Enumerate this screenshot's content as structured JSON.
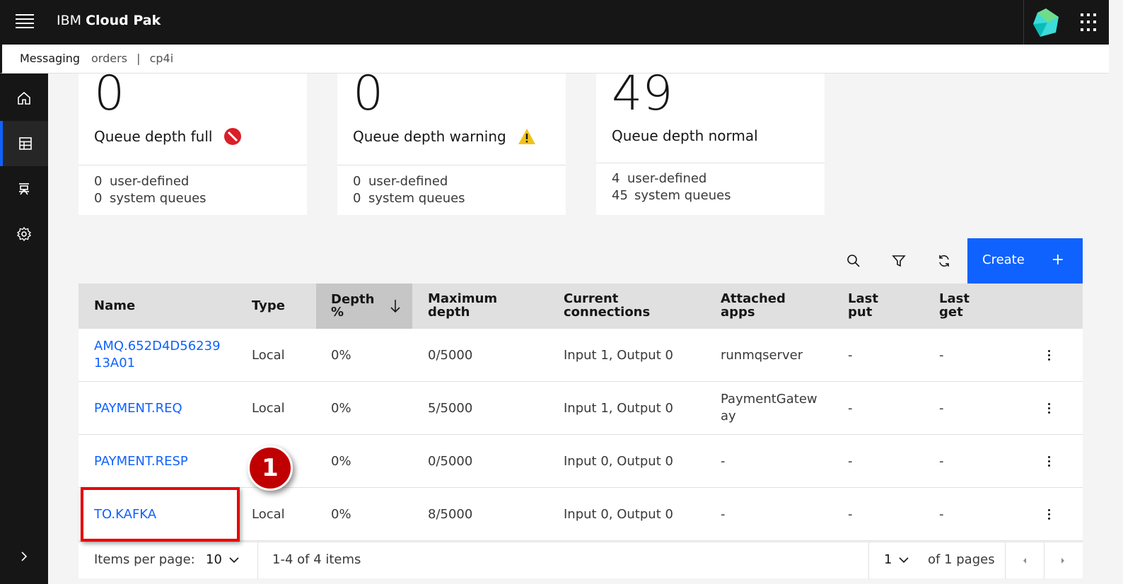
{
  "header": {
    "brand_ibm": "IBM",
    "brand_product": "Cloud Pak"
  },
  "breadcrumb": {
    "app": "Messaging",
    "path": [
      "orders",
      "|",
      "cp4i"
    ]
  },
  "nav": {
    "items": [
      "home-icon",
      "table-icon",
      "queue-manager-icon",
      "settings-icon"
    ],
    "active": "table-icon",
    "expand": "chevron-right-icon"
  },
  "cards": [
    {
      "count": "0",
      "title": "Queue depth full",
      "icon": "error-icon",
      "user_n": "0",
      "user_label": "user-defined",
      "system_n": "0",
      "system_label": "system queues"
    },
    {
      "count": "0",
      "title": "Queue depth warning",
      "icon": "warning-icon",
      "user_n": "0",
      "user_label": "user-defined",
      "system_n": "0",
      "system_label": "system queues"
    },
    {
      "count": "49",
      "title": "Queue depth normal",
      "icon": "",
      "user_n": "4",
      "user_label": "user-defined",
      "system_n": "45",
      "system_label": "system queues"
    }
  ],
  "toolbar": {
    "create_label": "Create",
    "create_icon": "+"
  },
  "table": {
    "headers": {
      "name": "Name",
      "type": "Type",
      "depth1": "Depth",
      "depth2": "%",
      "max1": "Maximum",
      "max2": "depth",
      "conn1": "Current",
      "conn2": "connections",
      "apps1": "Attached",
      "apps2": "apps",
      "put1": "Last",
      "put2": "put",
      "get1": "Last",
      "get2": "get"
    },
    "rows": [
      {
        "name1": "AMQ.652D4D56239",
        "name2": "13A01",
        "type": "Local",
        "depth": "0%",
        "max": "0/5000",
        "conn": "Input 1, Output 0",
        "apps1": "runmqserver",
        "apps2": "",
        "put": "-",
        "get": "-"
      },
      {
        "name1": "PAYMENT.REQ",
        "name2": "",
        "type": "Local",
        "depth": "0%",
        "max": "5/5000",
        "conn": "Input 1, Output 0",
        "apps1": "PaymentGatew",
        "apps2": "ay",
        "put": "-",
        "get": "-"
      },
      {
        "name1": "PAYMENT.RESP",
        "name2": "",
        "type": "",
        "depth": "0%",
        "max": "0/5000",
        "conn": "Input 0, Output 0",
        "apps1": "-",
        "apps2": "",
        "put": "-",
        "get": "-"
      },
      {
        "name1": "TO.KAFKA",
        "name2": "",
        "type": "Local",
        "depth": "0%",
        "max": "8/5000",
        "conn": "Input 0, Output 0",
        "apps1": "-",
        "apps2": "",
        "put": "-",
        "get": "-"
      }
    ]
  },
  "pagination": {
    "items_per_page_label": "Items per page:",
    "items_per_page": "10",
    "range": "1-4 of 4 items",
    "page": "1",
    "of_pages": "of 1 pages"
  },
  "annotation": {
    "step": "1"
  }
}
